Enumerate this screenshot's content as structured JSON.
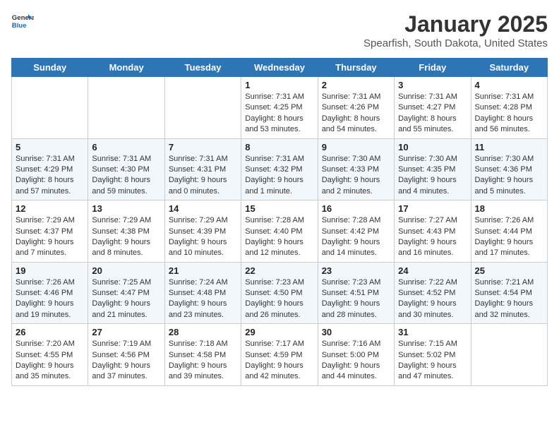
{
  "logo": {
    "line1": "General",
    "line2": "Blue"
  },
  "title": "January 2025",
  "location": "Spearfish, South Dakota, United States",
  "days_of_week": [
    "Sunday",
    "Monday",
    "Tuesday",
    "Wednesday",
    "Thursday",
    "Friday",
    "Saturday"
  ],
  "weeks": [
    [
      {
        "day": "",
        "info": ""
      },
      {
        "day": "",
        "info": ""
      },
      {
        "day": "",
        "info": ""
      },
      {
        "day": "1",
        "info": "Sunrise: 7:31 AM\nSunset: 4:25 PM\nDaylight: 8 hours\nand 53 minutes."
      },
      {
        "day": "2",
        "info": "Sunrise: 7:31 AM\nSunset: 4:26 PM\nDaylight: 8 hours\nand 54 minutes."
      },
      {
        "day": "3",
        "info": "Sunrise: 7:31 AM\nSunset: 4:27 PM\nDaylight: 8 hours\nand 55 minutes."
      },
      {
        "day": "4",
        "info": "Sunrise: 7:31 AM\nSunset: 4:28 PM\nDaylight: 8 hours\nand 56 minutes."
      }
    ],
    [
      {
        "day": "5",
        "info": "Sunrise: 7:31 AM\nSunset: 4:29 PM\nDaylight: 8 hours\nand 57 minutes."
      },
      {
        "day": "6",
        "info": "Sunrise: 7:31 AM\nSunset: 4:30 PM\nDaylight: 8 hours\nand 59 minutes."
      },
      {
        "day": "7",
        "info": "Sunrise: 7:31 AM\nSunset: 4:31 PM\nDaylight: 9 hours\nand 0 minutes."
      },
      {
        "day": "8",
        "info": "Sunrise: 7:31 AM\nSunset: 4:32 PM\nDaylight: 9 hours\nand 1 minute."
      },
      {
        "day": "9",
        "info": "Sunrise: 7:30 AM\nSunset: 4:33 PM\nDaylight: 9 hours\nand 2 minutes."
      },
      {
        "day": "10",
        "info": "Sunrise: 7:30 AM\nSunset: 4:35 PM\nDaylight: 9 hours\nand 4 minutes."
      },
      {
        "day": "11",
        "info": "Sunrise: 7:30 AM\nSunset: 4:36 PM\nDaylight: 9 hours\nand 5 minutes."
      }
    ],
    [
      {
        "day": "12",
        "info": "Sunrise: 7:29 AM\nSunset: 4:37 PM\nDaylight: 9 hours\nand 7 minutes."
      },
      {
        "day": "13",
        "info": "Sunrise: 7:29 AM\nSunset: 4:38 PM\nDaylight: 9 hours\nand 8 minutes."
      },
      {
        "day": "14",
        "info": "Sunrise: 7:29 AM\nSunset: 4:39 PM\nDaylight: 9 hours\nand 10 minutes."
      },
      {
        "day": "15",
        "info": "Sunrise: 7:28 AM\nSunset: 4:40 PM\nDaylight: 9 hours\nand 12 minutes."
      },
      {
        "day": "16",
        "info": "Sunrise: 7:28 AM\nSunset: 4:42 PM\nDaylight: 9 hours\nand 14 minutes."
      },
      {
        "day": "17",
        "info": "Sunrise: 7:27 AM\nSunset: 4:43 PM\nDaylight: 9 hours\nand 16 minutes."
      },
      {
        "day": "18",
        "info": "Sunrise: 7:26 AM\nSunset: 4:44 PM\nDaylight: 9 hours\nand 17 minutes."
      }
    ],
    [
      {
        "day": "19",
        "info": "Sunrise: 7:26 AM\nSunset: 4:46 PM\nDaylight: 9 hours\nand 19 minutes."
      },
      {
        "day": "20",
        "info": "Sunrise: 7:25 AM\nSunset: 4:47 PM\nDaylight: 9 hours\nand 21 minutes."
      },
      {
        "day": "21",
        "info": "Sunrise: 7:24 AM\nSunset: 4:48 PM\nDaylight: 9 hours\nand 23 minutes."
      },
      {
        "day": "22",
        "info": "Sunrise: 7:23 AM\nSunset: 4:50 PM\nDaylight: 9 hours\nand 26 minutes."
      },
      {
        "day": "23",
        "info": "Sunrise: 7:23 AM\nSunset: 4:51 PM\nDaylight: 9 hours\nand 28 minutes."
      },
      {
        "day": "24",
        "info": "Sunrise: 7:22 AM\nSunset: 4:52 PM\nDaylight: 9 hours\nand 30 minutes."
      },
      {
        "day": "25",
        "info": "Sunrise: 7:21 AM\nSunset: 4:54 PM\nDaylight: 9 hours\nand 32 minutes."
      }
    ],
    [
      {
        "day": "26",
        "info": "Sunrise: 7:20 AM\nSunset: 4:55 PM\nDaylight: 9 hours\nand 35 minutes."
      },
      {
        "day": "27",
        "info": "Sunrise: 7:19 AM\nSunset: 4:56 PM\nDaylight: 9 hours\nand 37 minutes."
      },
      {
        "day": "28",
        "info": "Sunrise: 7:18 AM\nSunset: 4:58 PM\nDaylight: 9 hours\nand 39 minutes."
      },
      {
        "day": "29",
        "info": "Sunrise: 7:17 AM\nSunset: 4:59 PM\nDaylight: 9 hours\nand 42 minutes."
      },
      {
        "day": "30",
        "info": "Sunrise: 7:16 AM\nSunset: 5:00 PM\nDaylight: 9 hours\nand 44 minutes."
      },
      {
        "day": "31",
        "info": "Sunrise: 7:15 AM\nSunset: 5:02 PM\nDaylight: 9 hours\nand 47 minutes."
      },
      {
        "day": "",
        "info": ""
      }
    ]
  ]
}
